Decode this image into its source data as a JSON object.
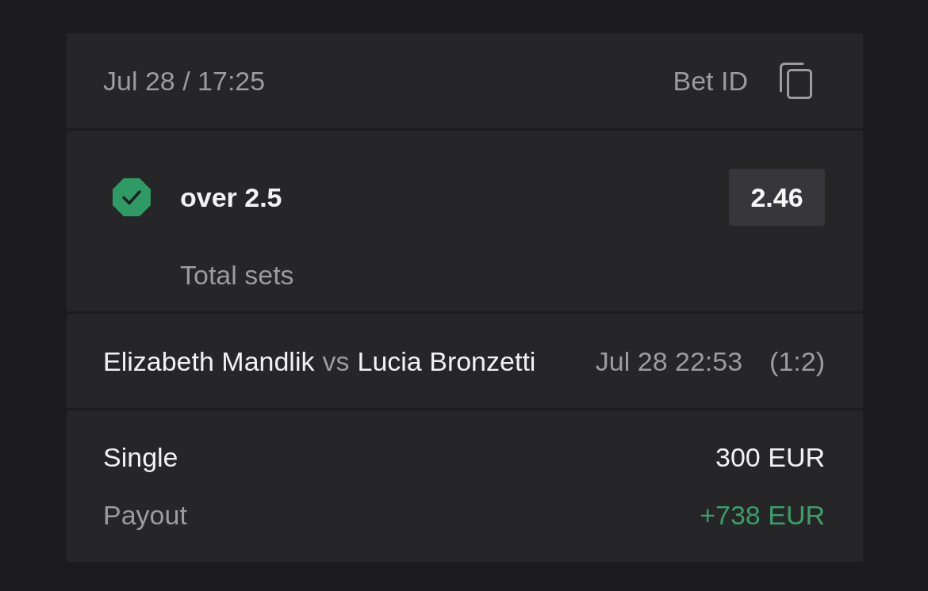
{
  "header": {
    "placed_at": "Jul 28 / 17:25",
    "bet_id_label": "Bet ID"
  },
  "selection": {
    "won": true,
    "pick": "over 2.5",
    "market": "Total sets",
    "odds": "2.46"
  },
  "event": {
    "home": "Elizabeth Mandlik",
    "separator": "vs",
    "away": "Lucia Bronzetti",
    "start_time": "Jul 28 22:53",
    "score": "(1:2)"
  },
  "summary": {
    "bet_type": "Single",
    "stake": "300 EUR",
    "payout_label": "Payout",
    "payout": "+738 EUR"
  }
}
